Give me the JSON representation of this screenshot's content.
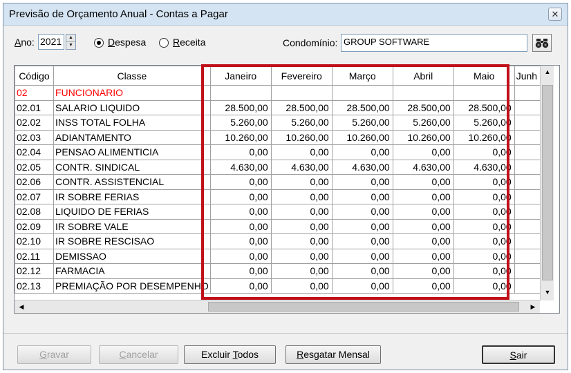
{
  "window": {
    "title": "Previsão de Orçamento Anual - Contas a Pagar",
    "close_glyph": "✕"
  },
  "toolbar": {
    "year_label_hot": "A",
    "year_label_rest": "no:",
    "year_value": "2021",
    "radio_despesa_hot": "D",
    "radio_despesa_rest": "espesa",
    "radio_receita_hot": "R",
    "radio_receita_rest": "eceita",
    "selected_radio": "Despesa",
    "condominio_label": "Condomínio:",
    "condominio_value": "GROUP SOFTWARE",
    "find_icon": "binoculars-icon"
  },
  "grid": {
    "columns": [
      "Código",
      "Classe",
      "Janeiro",
      "Fevereiro",
      "Março",
      "Abril",
      "Maio",
      "Junh"
    ],
    "rows": [
      {
        "code": "02",
        "classe": "FUNCIONARIO",
        "jan": "",
        "fev": "",
        "mar": "",
        "abr": "",
        "mai": "",
        "header": true
      },
      {
        "code": "02.01",
        "classe": "SALARIO LIQUIDO",
        "jan": "28.500,00",
        "fev": "28.500,00",
        "mar": "28.500,00",
        "abr": "28.500,00",
        "mai": "28.500,00"
      },
      {
        "code": "02.02",
        "classe": "INSS TOTAL FOLHA",
        "jan": "5.260,00",
        "fev": "5.260,00",
        "mar": "5.260,00",
        "abr": "5.260,00",
        "mai": "5.260,00"
      },
      {
        "code": "02.03",
        "classe": "ADIANTAMENTO",
        "jan": "10.260,00",
        "fev": "10.260,00",
        "mar": "10.260,00",
        "abr": "10.260,00",
        "mai": "10.260,00"
      },
      {
        "code": "02.04",
        "classe": "PENSAO ALIMENTICIA",
        "jan": "0,00",
        "fev": "0,00",
        "mar": "0,00",
        "abr": "0,00",
        "mai": "0,00"
      },
      {
        "code": "02.05",
        "classe": "CONTR. SINDICAL",
        "jan": "4.630,00",
        "fev": "4.630,00",
        "mar": "4.630,00",
        "abr": "4.630,00",
        "mai": "4.630,00"
      },
      {
        "code": "02.06",
        "classe": "CONTR. ASSISTENCIAL",
        "jan": "0,00",
        "fev": "0,00",
        "mar": "0,00",
        "abr": "0,00",
        "mai": "0,00"
      },
      {
        "code": "02.07",
        "classe": "IR SOBRE FERIAS",
        "jan": "0,00",
        "fev": "0,00",
        "mar": "0,00",
        "abr": "0,00",
        "mai": "0,00"
      },
      {
        "code": "02.08",
        "classe": "LIQUIDO DE FERIAS",
        "jan": "0,00",
        "fev": "0,00",
        "mar": "0,00",
        "abr": "0,00",
        "mai": "0,00"
      },
      {
        "code": "02.09",
        "classe": "IR SOBRE VALE",
        "jan": "0,00",
        "fev": "0,00",
        "mar": "0,00",
        "abr": "0,00",
        "mai": "0,00"
      },
      {
        "code": "02.10",
        "classe": "IR SOBRE RESCISAO",
        "jan": "0,00",
        "fev": "0,00",
        "mar": "0,00",
        "abr": "0,00",
        "mai": "0,00"
      },
      {
        "code": "02.11",
        "classe": "DEMISSAO",
        "jan": "0,00",
        "fev": "0,00",
        "mar": "0,00",
        "abr": "0,00",
        "mai": "0,00"
      },
      {
        "code": "02.12",
        "classe": "FARMACIA",
        "jan": "0,00",
        "fev": "0,00",
        "mar": "0,00",
        "abr": "0,00",
        "mai": "0,00"
      },
      {
        "code": "02.13",
        "classe": "PREMIAÇÃO POR DESEMPENHO",
        "jan": "0,00",
        "fev": "0,00",
        "mar": "0,00",
        "abr": "0,00",
        "mai": "0,00"
      }
    ]
  },
  "buttons": {
    "gravar_hot": "G",
    "gravar_rest": "ravar",
    "cancelar_hot": "C",
    "cancelar_rest": "ancelar",
    "excluir_pre": "Excluir ",
    "excluir_hot": "T",
    "excluir_rest": "odos",
    "resgatar_hot": "R",
    "resgatar_rest": "esgatar Mensal",
    "sair_hot": "S",
    "sair_rest": "air"
  },
  "colors": {
    "header_row_text": "#ff0000",
    "highlight_border": "#c0101a"
  }
}
